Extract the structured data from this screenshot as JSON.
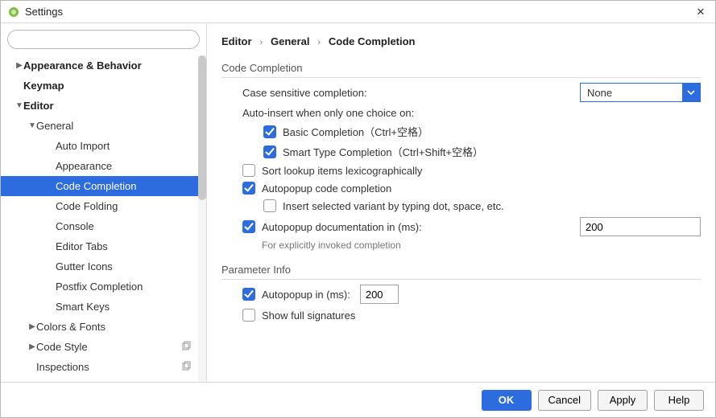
{
  "window": {
    "title": "Settings"
  },
  "search": {
    "placeholder": ""
  },
  "sidebar": {
    "items": [
      {
        "label": "Appearance & Behavior",
        "level": 0,
        "caret": "right",
        "bold": true
      },
      {
        "label": "Keymap",
        "level": 0,
        "caret": "",
        "bold": true
      },
      {
        "label": "Editor",
        "level": 0,
        "caret": "down",
        "bold": true
      },
      {
        "label": "General",
        "level": 1,
        "caret": "down",
        "bold": false
      },
      {
        "label": "Auto Import",
        "level": 2,
        "caret": "",
        "bold": false
      },
      {
        "label": "Appearance",
        "level": 2,
        "caret": "",
        "bold": false
      },
      {
        "label": "Code Completion",
        "level": 2,
        "caret": "",
        "bold": false,
        "selected": true
      },
      {
        "label": "Code Folding",
        "level": 2,
        "caret": "",
        "bold": false
      },
      {
        "label": "Console",
        "level": 2,
        "caret": "",
        "bold": false
      },
      {
        "label": "Editor Tabs",
        "level": 2,
        "caret": "",
        "bold": false
      },
      {
        "label": "Gutter Icons",
        "level": 2,
        "caret": "",
        "bold": false
      },
      {
        "label": "Postfix Completion",
        "level": 2,
        "caret": "",
        "bold": false
      },
      {
        "label": "Smart Keys",
        "level": 2,
        "caret": "",
        "bold": false
      },
      {
        "label": "Colors & Fonts",
        "level": 1,
        "caret": "right",
        "bold": false
      },
      {
        "label": "Code Style",
        "level": 1,
        "caret": "right",
        "bold": false,
        "copy": true
      },
      {
        "label": "Inspections",
        "level": 1,
        "caret": "",
        "bold": false,
        "copy": true
      }
    ]
  },
  "breadcrumb": {
    "a": "Editor",
    "b": "General",
    "c": "Code Completion"
  },
  "cc": {
    "section1": "Code Completion",
    "caseLabel": "Case sensitive completion:",
    "caseValue": "None",
    "autoInsertLabel": "Auto-insert when only one choice on:",
    "basic": "Basic Completion（Ctrl+空格）",
    "smart": "Smart Type Completion（Ctrl+Shift+空格）",
    "sortLex": "Sort lookup items lexicographically",
    "autopopup": "Autopopup code completion",
    "insertVariant": "Insert selected variant by typing dot, space, etc.",
    "autodocLabel": "Autopopup documentation in (ms):",
    "autodocValue": "200",
    "autodocHint": "For explicitly invoked completion",
    "section2": "Parameter Info",
    "paramAutopopupLabel": "Autopopup in (ms):",
    "paramAutopopupValue": "200",
    "showFull": "Show full signatures"
  },
  "footer": {
    "ok": "OK",
    "cancel": "Cancel",
    "apply": "Apply",
    "help": "Help"
  }
}
